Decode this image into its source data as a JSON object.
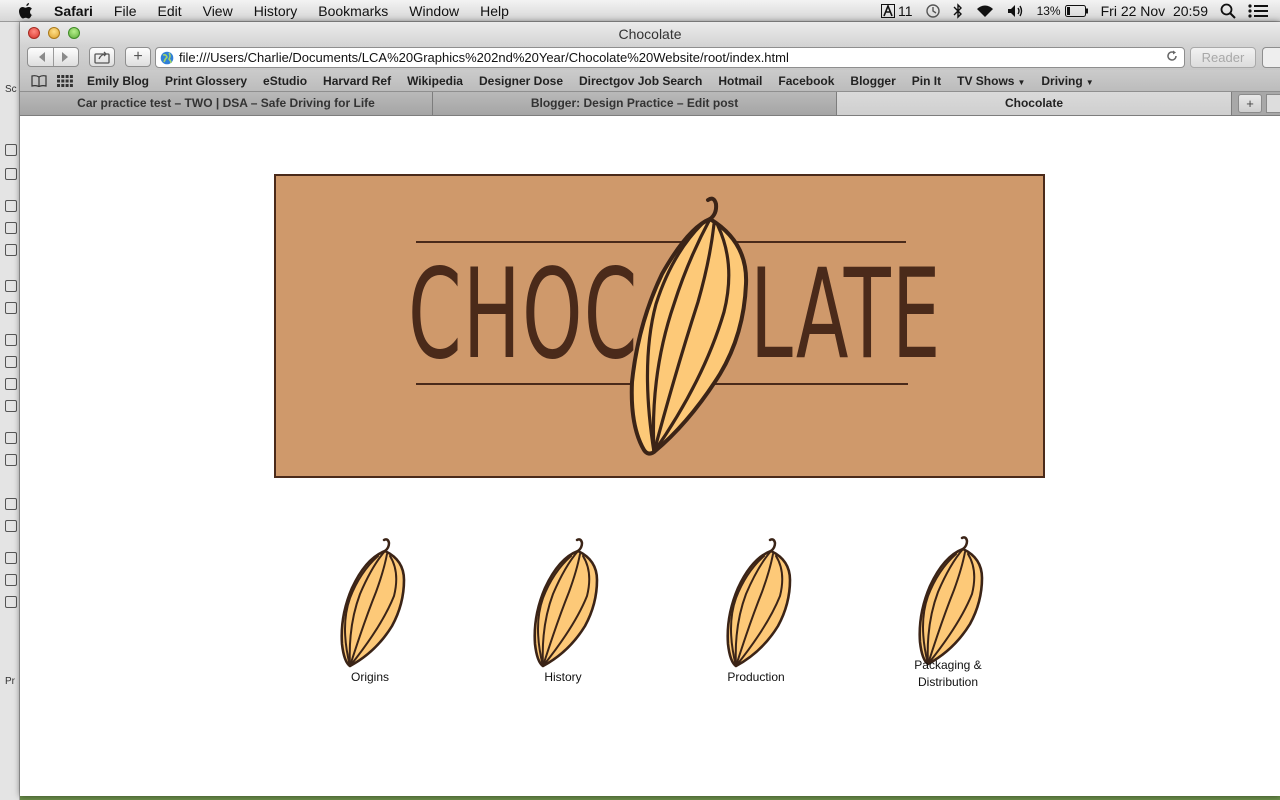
{
  "menubar": {
    "app": "Safari",
    "items": [
      "File",
      "Edit",
      "View",
      "History",
      "Bookmarks",
      "Window",
      "Help"
    ],
    "status": {
      "adobe_count": "11",
      "battery": "13%",
      "clock": "Fri 22 Nov  20:59"
    }
  },
  "left_strip": {
    "label_top": "Sc",
    "label_bottom": "Pr"
  },
  "window": {
    "title": "Chocolate",
    "url": "file:///Users/Charlie/Documents/LCA%20Graphics%202nd%20Year/Chocolate%20Website/root/index.html",
    "reader_label": "Reader",
    "new_tab_label": "+"
  },
  "bookmarks": [
    "Emily Blog",
    "Print Glossery",
    "eStudio",
    "Harvard Ref",
    "Wikipedia",
    "Designer Dose",
    "Directgov Job Search",
    "Hotmail",
    "Facebook",
    "Blogger",
    "Pin It",
    "TV Shows",
    "Driving"
  ],
  "bookmark_folders": [
    "TV Shows",
    "Driving"
  ],
  "tabs": [
    {
      "label": "Car practice test – TWO | DSA – Safe Driving for Life",
      "active": false
    },
    {
      "label": "Blogger: Design Practice – Edit post",
      "active": false
    },
    {
      "label": "Chocolate",
      "active": true
    }
  ],
  "page": {
    "logo_left": "CHOC",
    "logo_right": "LATE",
    "colors": {
      "banner": "#cf996b",
      "ink": "#4a2a1a",
      "pod": "#fdc978"
    },
    "nav": [
      {
        "line1": "Origins",
        "line2": ""
      },
      {
        "line1": "History",
        "line2": ""
      },
      {
        "line1": "Production",
        "line2": ""
      },
      {
        "line1": "Packaging &",
        "line2": "Distribution"
      }
    ]
  }
}
